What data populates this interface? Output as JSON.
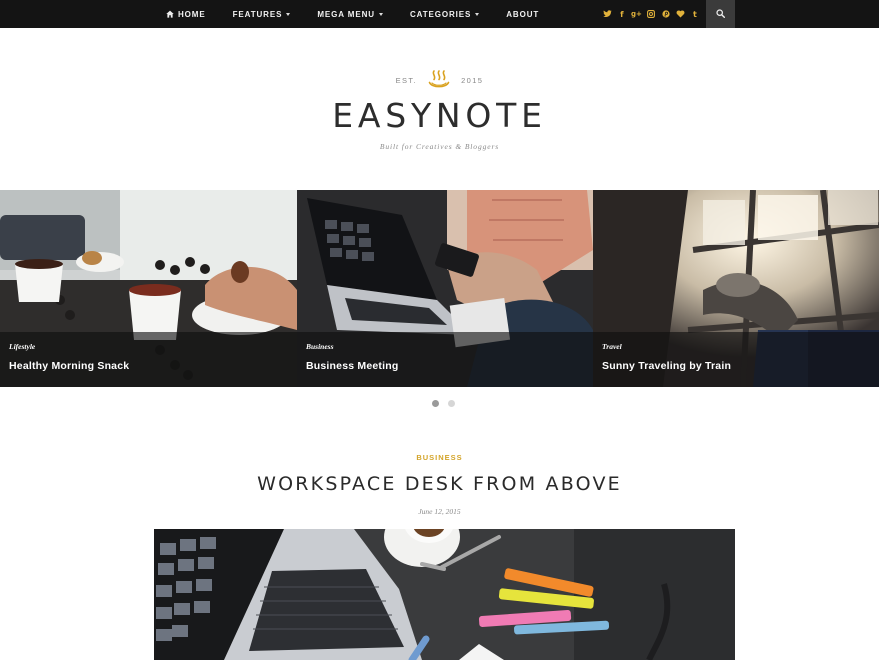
{
  "nav": {
    "items": [
      {
        "label": "HOME",
        "icon": "home-icon"
      },
      {
        "label": "FEATURES",
        "icon": "chevron-down-icon"
      },
      {
        "label": "MEGA MENU",
        "icon": "chevron-down-icon"
      },
      {
        "label": "CATEGORIES",
        "icon": "chevron-down-icon"
      },
      {
        "label": "ABOUT"
      }
    ],
    "social": [
      {
        "icon": "twitter-icon",
        "glyph": "🐦"
      },
      {
        "icon": "facebook-icon",
        "glyph": "f"
      },
      {
        "icon": "google-plus-icon",
        "glyph": "g+"
      },
      {
        "icon": "instagram-icon",
        "glyph": "◻"
      },
      {
        "icon": "pinterest-icon",
        "glyph": "℗"
      },
      {
        "icon": "heart-icon",
        "glyph": "♥"
      },
      {
        "icon": "tumblr-icon",
        "glyph": "t"
      }
    ],
    "search_icon": "search-icon"
  },
  "header": {
    "est": "EST.",
    "year": "2015",
    "title": "EASYNOTE",
    "tagline": "Built for Creatives & Bloggers"
  },
  "slider": {
    "slides": [
      {
        "category": "Lifestyle",
        "title": "Healthy Morning Snack"
      },
      {
        "category": "Business",
        "title": "Business Meeting"
      },
      {
        "category": "Travel",
        "title": "Sunny Traveling by Train"
      }
    ],
    "pages": 2,
    "active_page": 1
  },
  "post": {
    "category": "BUSINESS",
    "title": "WORKSPACE DESK FROM ABOVE",
    "date": "June 12, 2015"
  },
  "colors": {
    "accent": "#d4a52b",
    "topbar": "#141414",
    "search_bg": "#3b3b3b"
  }
}
